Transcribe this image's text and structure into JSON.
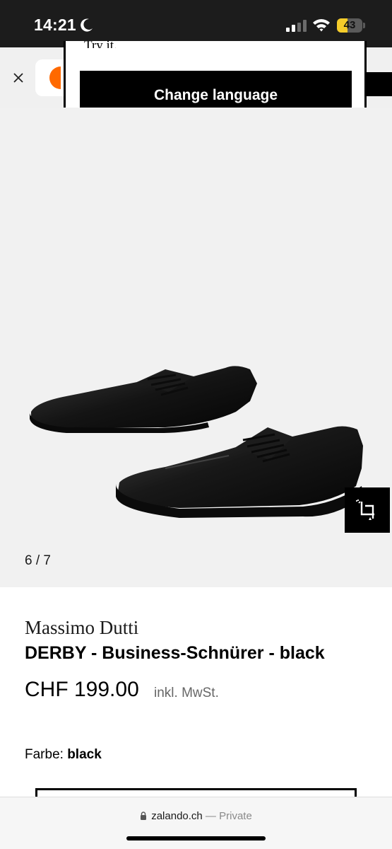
{
  "status_bar": {
    "time": "14:21",
    "battery": "43",
    "battery_level": 0.43
  },
  "popover": {
    "text_partial": "Try it.",
    "button_label": "Change language"
  },
  "gallery": {
    "counter": "6 / 7"
  },
  "product": {
    "brand": "Massimo Dutti",
    "name": "DERBY - Business-Schnürer - black",
    "price": "CHF 199.00",
    "vat_note": "inkl. MwSt.",
    "color_label": "Farbe:",
    "color_value": "black"
  },
  "browser": {
    "domain": "zalando.ch",
    "separator": " — ",
    "mode": "Private"
  },
  "colors": {
    "status_bar_bg": "#1c1c1c",
    "brand_orange": "#ff6900",
    "button_bg": "#000000",
    "battery_yellow": "#f5cc2a"
  }
}
